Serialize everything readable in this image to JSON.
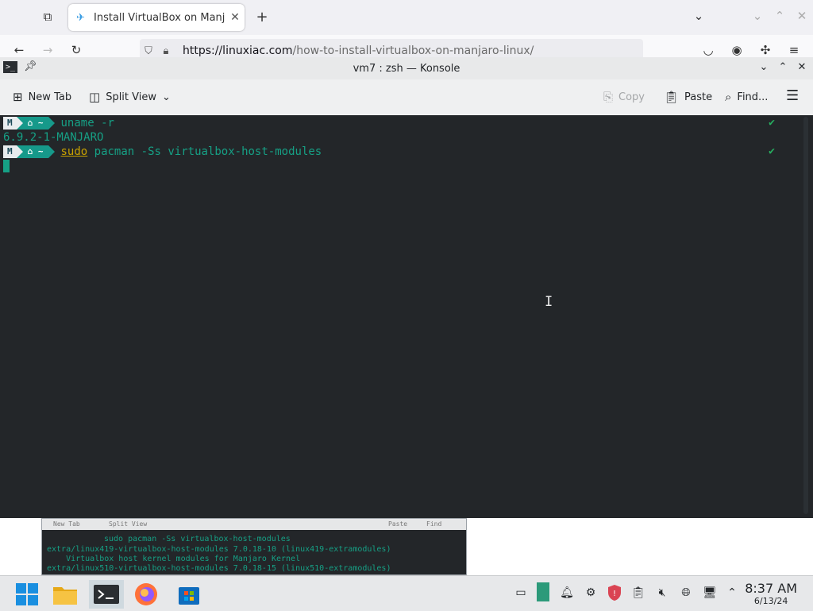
{
  "browser": {
    "tab_title": "Install VirtualBox on Manj",
    "url_host": "https://linuxiac.com",
    "url_path": "/how-to-install-virtualbox-on-manjaro-linux/"
  },
  "konsole": {
    "window_title": "vm7 : zsh — Konsole",
    "toolbar": {
      "new_tab": "New Tab",
      "split_view": "Split View",
      "copy": "Copy",
      "paste": "Paste",
      "find": "Find..."
    },
    "terminal": {
      "prompt_logo": "M",
      "prompt_home": "⌂ ~",
      "line1_cmd": "uname -r",
      "line2_output": "6.9.2-1-MANJARO",
      "line3_sudo": "sudo",
      "line3_rest": " pacman -Ss virtualbox-host-modules",
      "check": "✔"
    }
  },
  "background_thumbnail": {
    "toolbar_new_tab": "New Tab",
    "toolbar_split": "Split View",
    "toolbar_paste": "Paste",
    "toolbar_find": "Find",
    "cmd": "sudo pacman -Ss virtualbox-host-modules",
    "out1": "extra/linux419-virtualbox-host-modules 7.0.18-10 (linux419-extramodules)",
    "out2": "    Virtualbox host kernel modules for Manjaro Kernel",
    "out3": "extra/linux510-virtualbox-host-modules 7.0.18-15 (linux510-extramodules)"
  },
  "taskbar": {
    "time": "8:37 AM",
    "date": "6/13/24"
  },
  "colors": {
    "terminal_bg": "#232629",
    "terminal_green": "#16a085",
    "sudo_yellow": "#c8a200",
    "prompt_teal": "#16998a"
  }
}
